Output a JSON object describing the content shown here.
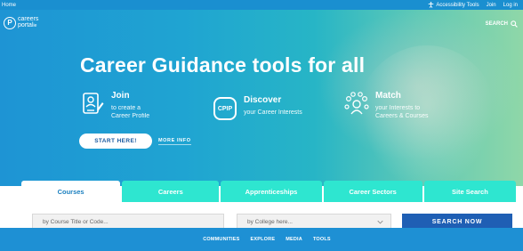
{
  "topbar": {
    "home": "Home",
    "accessibility": "Accessibility Tools",
    "join": "Join",
    "login": "Log in"
  },
  "logo": {
    "line1": "careers",
    "line2": "portal",
    "suffix": "ie"
  },
  "header": {
    "search_label": "SEARCH"
  },
  "hero": {
    "headline": "Career Guidance tools for all",
    "features": [
      {
        "title": "Join",
        "desc_line1": "to create a",
        "desc_line2": "Career Profile",
        "icon": "profile-document-icon"
      },
      {
        "title": "Discover",
        "desc_line1": "your Career Interests",
        "desc_line2": "",
        "icon_text": "CPIP"
      },
      {
        "title": "Match",
        "desc_line1": "your Interests to",
        "desc_line2": "Careers & Courses",
        "icon": "match-people-icon"
      }
    ],
    "start_button": "START HERE!",
    "more_info": "MORE INFO"
  },
  "tabs": [
    "Courses",
    "Careers",
    "Apprenticeships",
    "Career Sectors",
    "Site Search"
  ],
  "search": {
    "course_placeholder": "by Course Title or Code...",
    "college_placeholder": "by College here...",
    "button": "SEARCH NOW"
  },
  "bottom_nav": [
    "COMMUNITIES",
    "EXPLORE",
    "MEDIA",
    "TOOLS"
  ],
  "colors": {
    "topbar": "#1a8fd0",
    "tab_inactive": "#2ee6d0",
    "search_button": "#1f5fb4",
    "bottom_nav": "#1e90d4"
  }
}
